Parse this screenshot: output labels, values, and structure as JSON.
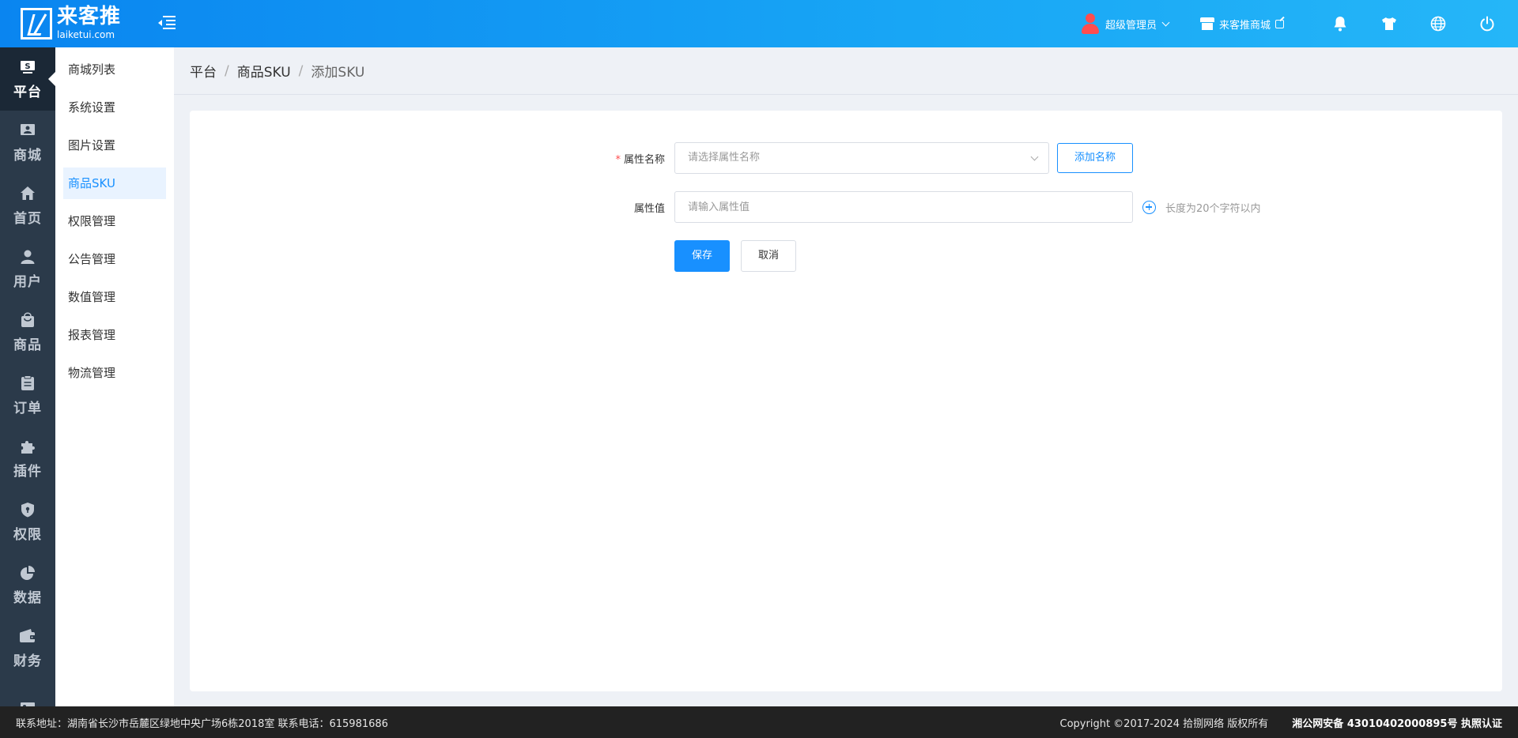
{
  "header": {
    "logo_name": "来客推",
    "logo_domain": "laiketui.com",
    "user_name": "超级管理员",
    "shop_label": "来客推商城",
    "icons": [
      "bell-icon",
      "tshirt-icon",
      "globe-icon",
      "power-icon"
    ]
  },
  "iconnav": {
    "items": [
      {
        "label": "平台",
        "icon": "platform-icon",
        "active": true
      },
      {
        "label": "商城",
        "icon": "store-icon"
      },
      {
        "label": "首页",
        "icon": "home-icon"
      },
      {
        "label": "用户",
        "icon": "user-icon"
      },
      {
        "label": "商品",
        "icon": "bag-icon"
      },
      {
        "label": "订单",
        "icon": "clipboard-icon"
      },
      {
        "label": "插件",
        "icon": "puzzle-icon"
      },
      {
        "label": "权限",
        "icon": "shield-icon"
      },
      {
        "label": "数据",
        "icon": "pie-chart-icon"
      },
      {
        "label": "财务",
        "icon": "wallet-icon"
      },
      {
        "label": "",
        "icon": "image-icon"
      }
    ]
  },
  "submenu": {
    "items": [
      {
        "label": "商城列表"
      },
      {
        "label": "系统设置"
      },
      {
        "label": "图片设置"
      },
      {
        "label": "商品SKU",
        "active": true
      },
      {
        "label": "权限管理"
      },
      {
        "label": "公告管理"
      },
      {
        "label": "数值管理"
      },
      {
        "label": "报表管理"
      },
      {
        "label": "物流管理"
      }
    ]
  },
  "breadcrumb": {
    "items": [
      "平台",
      "商品SKU",
      "添加SKU"
    ]
  },
  "form": {
    "attr_name_label": "属性名称",
    "attr_name_required_mark": "*",
    "attr_name_placeholder": "请选择属性名称",
    "add_name_button": "添加名称",
    "attr_value_label": "属性值",
    "attr_value_placeholder": "请输入属性值",
    "attr_value_hint": "长度为20个字符以内",
    "save_button": "保存",
    "cancel_button": "取消"
  },
  "footer": {
    "address": "联系地址：湖南省长沙市岳麓区绿地中央广场6栋2018室 联系电话：615981686",
    "copyright": "Copyright ©2017-2024 拾捌网络 版权所有",
    "icp": "湘公网安备 43010402000895号 执照认证"
  }
}
